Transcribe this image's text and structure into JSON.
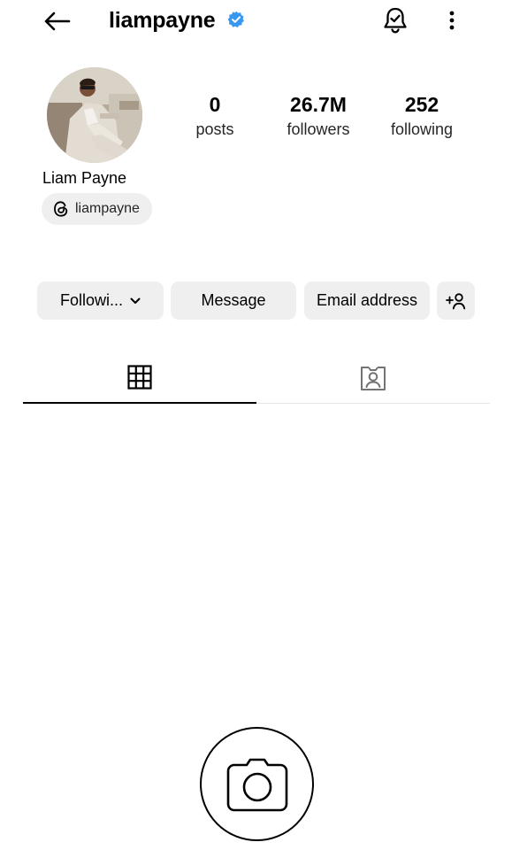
{
  "header": {
    "username": "liampayne",
    "back_icon": "arrow-left-icon",
    "verified_icon": "verified-badge-icon",
    "bell_icon": "bell-check-icon",
    "more_icon": "more-vertical-icon",
    "verified_color": "#3897f0"
  },
  "profile": {
    "display_name": "Liam Payne",
    "threads_handle": "liampayne",
    "stats": {
      "posts_count": "0",
      "posts_label": "posts",
      "followers_count": "26.7M",
      "followers_label": "followers",
      "following_count": "252",
      "following_label": "following"
    }
  },
  "actions": {
    "following_label": "Followi...",
    "message_label": "Message",
    "email_label": "Email address",
    "add_user_icon": "add-user-icon"
  },
  "tabs": {
    "grid_icon": "grid-icon",
    "tagged_icon": "tagged-person-icon"
  },
  "empty_state": {
    "icon": "camera-icon"
  }
}
